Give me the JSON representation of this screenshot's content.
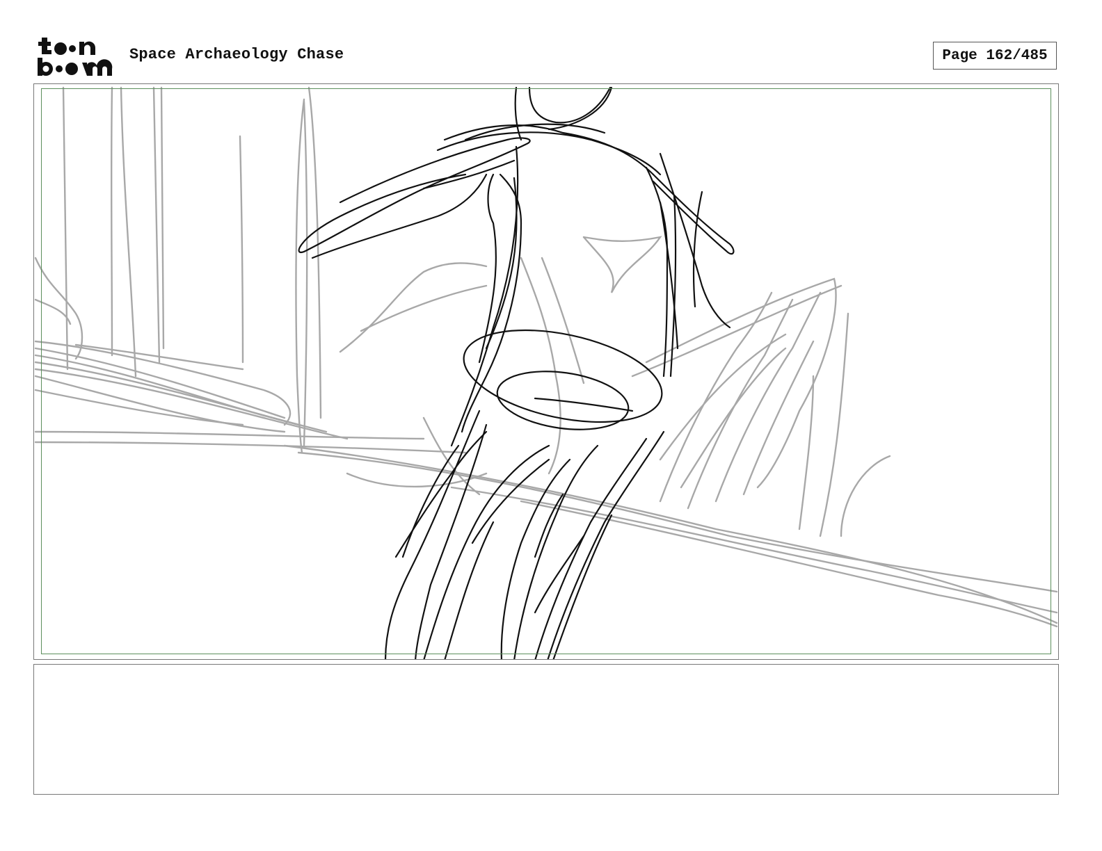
{
  "header": {
    "logo_line1": "toon",
    "logo_line2": "boom",
    "project_title": "Space Archaeology Chase",
    "page_label": "Page 162/485"
  },
  "panel": {
    "image_name": "rough-sketch-figure-running"
  },
  "notes": {
    "text": ""
  }
}
